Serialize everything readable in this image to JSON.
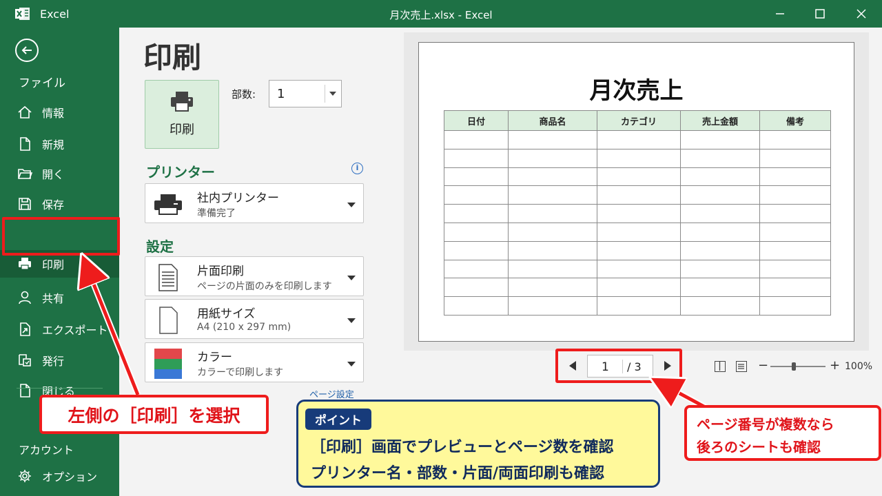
{
  "titlebar": {
    "app_name": "Excel",
    "document_title": "月次売上.xlsx  -  Excel",
    "controls": [
      "minimize-icon",
      "maximize-icon",
      "close-icon"
    ]
  },
  "sidebar": {
    "file_label": "ファイル",
    "items": [
      {
        "label": "情報",
        "icon": "home-icon"
      },
      {
        "label": "新規",
        "icon": "new-document-icon"
      },
      {
        "label": "開く",
        "icon": "folder-open-icon"
      },
      {
        "label": "保存",
        "icon": "save-icon"
      },
      {
        "label": "印刷",
        "icon": "printer-icon",
        "active": true
      },
      {
        "label": "共有",
        "icon": "person-icon"
      },
      {
        "label": "エクスポート",
        "icon": "export-icon"
      },
      {
        "label": "発行",
        "icon": "publish-icon"
      },
      {
        "label": "閉じる",
        "icon": "close-document-icon"
      }
    ],
    "account_label": "アカウント",
    "options_label": "オプション"
  },
  "print_panel": {
    "heading": "印刷",
    "print_button_label": "印刷",
    "copies_label": "部数:",
    "copies_value": "1",
    "printer_section": "プリンター",
    "printer_name": "社内プリンター",
    "printer_status": "準備完了",
    "settings_section": "設定",
    "settings": [
      {
        "title": "片面印刷",
        "subtitle": "ページの片面のみを印刷します",
        "icon": "document-lines-icon"
      },
      {
        "title": "用紙サイズ",
        "subtitle": "A4 (210 x 297 mm)",
        "icon": "paper-icon"
      },
      {
        "title": "カラー",
        "subtitle": "カラーで印刷します",
        "icon": "color-swatch-icon"
      }
    ],
    "page_setup_link": "ページ設定"
  },
  "preview": {
    "sheet_title": "月次売上",
    "columns": [
      "日付",
      "商品名",
      "カテゴリ",
      "売上金額",
      "備考"
    ],
    "empty_rows": 10,
    "current_page": "1",
    "total_pages": "/ 3",
    "zoom_minus": "−",
    "zoom_plus": "+",
    "zoom": "100%"
  },
  "callouts": {
    "left": "左側の［印刷］を選択",
    "center_badge": "ポイント",
    "center_line1": "［印刷］画面でプレビューとページ数を確認",
    "center_line2": "プリンター名・部数・片面/両面印刷も確認",
    "right_line1": "ページ番号が複数なら",
    "right_line2": "後ろのシートも確認"
  },
  "colors": {
    "excel_green": "#1e7145",
    "active_nav": "#185c37",
    "highlight_red": "#ee1c1c",
    "note_yellow": "#fff99b",
    "note_navy": "#173b7a"
  }
}
